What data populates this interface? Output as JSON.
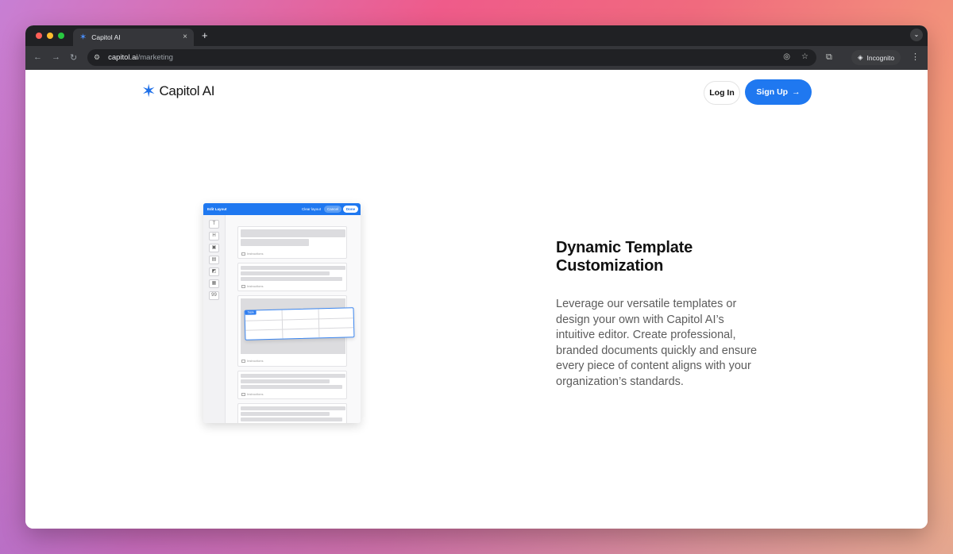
{
  "browser": {
    "tab_title": "Capitol AI",
    "url_domain": "capitol.ai",
    "url_path": "/marketing",
    "incognito_label": "Incognito",
    "new_tab_symbol": "+",
    "close_symbol": "×"
  },
  "site": {
    "logo_text": "Capitol AI",
    "login_label": "Log In",
    "signup_label": "Sign Up",
    "signup_arrow": "→",
    "brand_color": "#1f78f0"
  },
  "editor": {
    "title": "Edit Layout",
    "clear_label": "Clear layout",
    "cancel_label": "Cancel",
    "done_label": "Done",
    "tools": [
      "T",
      "H",
      "▣",
      "▤",
      "◩",
      "▦",
      "99"
    ],
    "instructions_label": "Instructions",
    "table_tag": "Table"
  },
  "feature": {
    "heading": "Dynamic Template Customization",
    "description": "Leverage our versatile templates or design your own with Capitol AI’s intuitive editor. Create professional, branded documents quickly and ensure every piece of content aligns with your organization’s standards."
  }
}
